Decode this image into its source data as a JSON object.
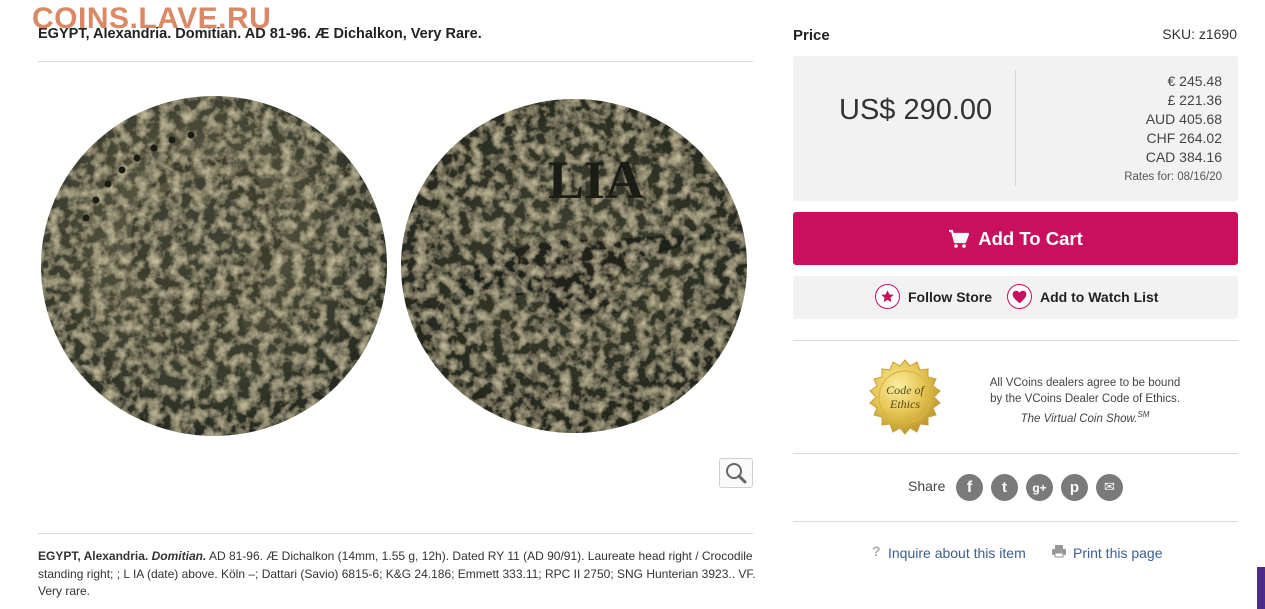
{
  "watermark": "COINS.LAVE.RU",
  "product": {
    "title": "EGYPT, Alexandria. Domitian. AD 81-96. Æ Dichalkon, Very Rare.",
    "description": {
      "lead": "EGYPT, Alexandria.",
      "ruler": "Domitian.",
      "body": "AD 81-96. Æ Dichalkon (14mm, 1.55 g, 12h). Dated RY 11 (AD 90/91). Laureate head right / Crocodile standing right; ; L IA (date) above. Köln –; Dattari (Savio) 6815-6; K&G 24.186; Emmett 333.11; RPC II 2750; SNG Hunterian 3923.. VF. Very rare."
    },
    "coin_legend": "LIA"
  },
  "price": {
    "label": "Price",
    "sku": "SKU: z1690",
    "main": "US$ 290.00",
    "conversions": [
      "€ 245.48",
      "£ 221.36",
      "AUD 405.68",
      "CHF 264.02",
      "CAD 384.16"
    ],
    "rates_date": "Rates for: 08/16/20"
  },
  "actions": {
    "add_to_cart": "Add To Cart",
    "follow_store": "Follow Store",
    "add_watch": "Add to Watch List"
  },
  "ethics": {
    "seal_line1": "Code of",
    "seal_line2": "Ethics",
    "line1": "All VCoins dealers agree to be bound",
    "line2": "by the VCoins Dealer Code of Ethics.",
    "line3": "The Virtual Coin Show.",
    "mark": "SM"
  },
  "share": {
    "label": "Share",
    "icons": [
      "facebook-icon",
      "twitter-icon",
      "google-plus-icon",
      "pinterest-icon",
      "email-icon"
    ],
    "glyphs": [
      "f",
      "t",
      "g+",
      "p",
      "✉"
    ]
  },
  "links": {
    "inquire": "Inquire about this item",
    "print": "Print this page"
  },
  "colors": {
    "accent": "#c8105e",
    "link": "#3a5f8f",
    "panel": "#f2f2f2"
  }
}
